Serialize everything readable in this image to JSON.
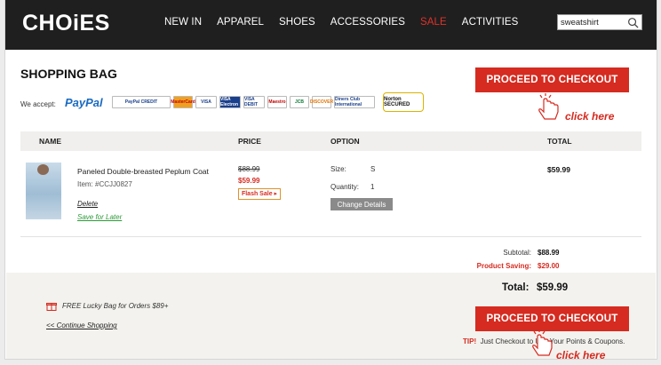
{
  "header": {
    "logo": "CHOiES",
    "nav": [
      "NEW IN",
      "APPAREL",
      "SHOES",
      "ACCESSORIES",
      "SALE",
      "ACTIVITIES"
    ],
    "search_value": "sweatshirt"
  },
  "page": {
    "title": "SHOPPING BAG",
    "we_accept": "We accept:",
    "paypal": "PayPal",
    "payment_cards": [
      "PayPal CREDIT",
      "MasterCard",
      "VISA",
      "VISA Electron",
      "VISA DEBIT",
      "Maestro",
      "JCB",
      "DISCOVER",
      "Diners Club International"
    ],
    "norton": "Norton SECURED",
    "checkout_label": "PROCEED TO CHECKOUT",
    "click_here": "click here"
  },
  "table": {
    "headers": {
      "name": "NAME",
      "price": "PRICE",
      "option": "OPTION",
      "total": "TOTAL"
    }
  },
  "item": {
    "name": "Paneled Double-breasted Peplum Coat",
    "item_no": "Item: #CCJJ0827",
    "delete": "Delete",
    "save_later": "Save for Later",
    "old_price": "$88.99",
    "new_price": "$59.99",
    "flash_sale": "Flash Sale ▸",
    "size_label": "Size:",
    "size_value": "S",
    "qty_label": "Quantity:",
    "qty_value": "1",
    "change_details": "Change Details",
    "total": "$59.99"
  },
  "summary": {
    "subtotal_label": "Subtotal:",
    "subtotal_value": "$88.99",
    "saving_label": "Product Saving:",
    "saving_value": "$29.00",
    "total_label": "Total:",
    "total_value": "$59.99",
    "lucky_bag": "FREE Lucky Bag for Orders $89+",
    "continue": "<< Continue Shopping",
    "tip_label": "TIP!",
    "tip_text": "Just Checkout to Use Your Points & Coupons."
  },
  "colors": {
    "accent": "#d62b20",
    "topbar": "#1f1f1f",
    "green": "#2e9a39"
  }
}
